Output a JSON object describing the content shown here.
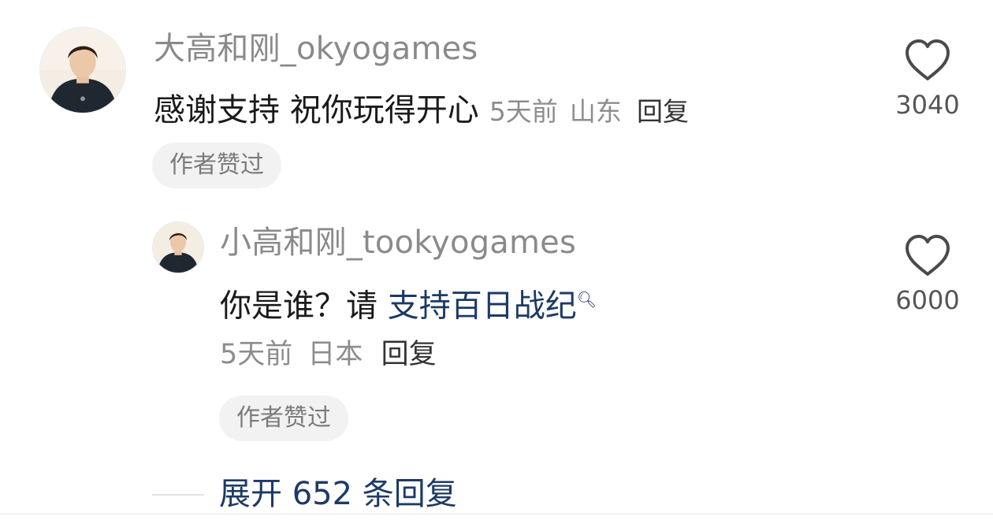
{
  "comment": {
    "username": "大高和刚_okyogames",
    "text": "感谢支持 祝你玩得开心",
    "time": "5天前",
    "location": "山东",
    "reply_label": "回复",
    "badge": "作者赞过",
    "likes": "3040",
    "avatar_icon": "user-avatar-icon"
  },
  "reply": {
    "username": "小高和刚_tookyogames",
    "text": "你是谁？请 ",
    "topic": "支持百日战纪",
    "time": "5天前",
    "location": "日本",
    "reply_label": "回复",
    "badge": "作者赞过",
    "likes": "6000",
    "avatar_icon": "user-avatar-icon"
  },
  "expand": {
    "label": "展开 652 条回复"
  },
  "icons": {
    "like": "heart-outline-icon",
    "topic_search": "search-icon"
  },
  "colors": {
    "link": "#1d3a66",
    "muted": "#8d8d8d",
    "badge_bg": "#f2f2f2"
  }
}
